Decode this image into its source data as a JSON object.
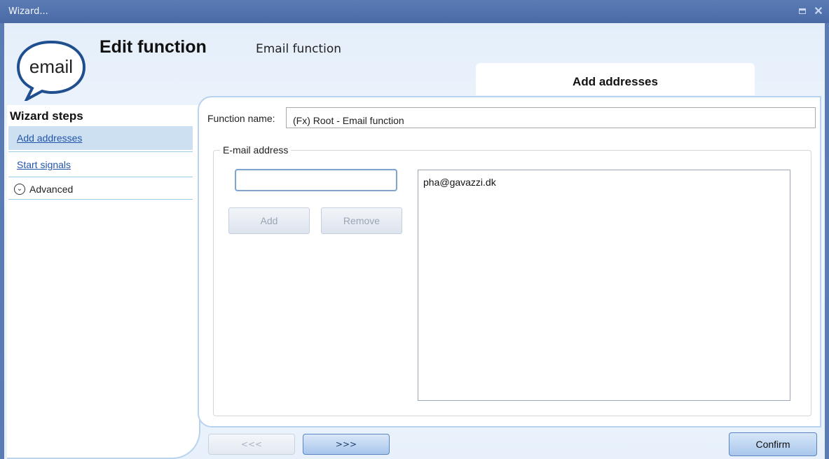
{
  "window": {
    "title": "Wizard...",
    "controls": {
      "maximize_icon": "maximize-icon",
      "close_icon": "close-icon"
    }
  },
  "header": {
    "logo_text": "email",
    "title": "Edit function",
    "subtitle": "Email function",
    "current_step_tab": "Add addresses"
  },
  "sidebar": {
    "heading": "Wizard steps",
    "items": [
      {
        "label": "Add addresses",
        "active": true
      },
      {
        "label": "Start signals",
        "active": false
      }
    ],
    "advanced": {
      "label": "Advanced",
      "icon": "chevron-down-circle-icon"
    }
  },
  "form": {
    "function_name_label": "Function name:",
    "function_name_value": "(Fx) Root - Email function",
    "email_group_label": "E-mail address",
    "email_input_value": "",
    "add_label": "Add",
    "remove_label": "Remove",
    "email_list": [
      "pha@gavazzi.dk"
    ]
  },
  "footer": {
    "prev_label": "<<<",
    "next_label": ">>>",
    "confirm_label": "Confirm"
  },
  "colors": {
    "titlebar": "#5b7bb5",
    "panel_border": "#b9d3ee",
    "active_step_bg": "#cde0f1",
    "link": "#2255aa"
  }
}
